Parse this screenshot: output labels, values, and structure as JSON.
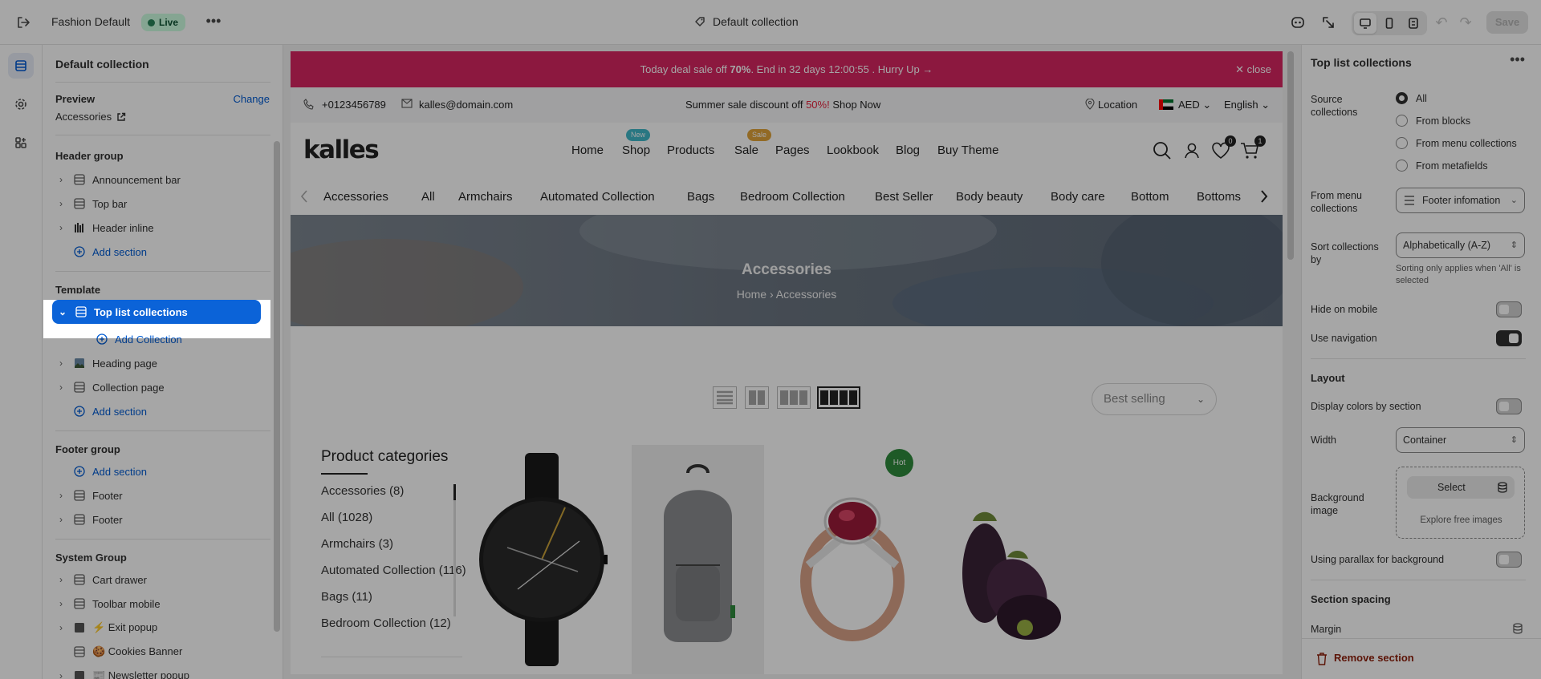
{
  "topbar": {
    "theme_name": "Fashion Default",
    "status_badge": "Live",
    "page_selector": "Default collection",
    "save_label": "Save"
  },
  "sidebar": {
    "title": "Default collection",
    "preview_label": "Preview",
    "preview_change": "Change",
    "preview_value": "Accessories",
    "header_group": {
      "label": "Header group",
      "items": [
        "Announcement bar",
        "Top bar",
        "Header inline"
      ],
      "add_section": "Add section"
    },
    "template": {
      "label": "Template",
      "selected": "Top list collections",
      "add_collection": "Add Collection",
      "items": [
        "Heading page",
        "Collection page"
      ],
      "add_section": "Add section"
    },
    "footer_group": {
      "label": "Footer group",
      "add_section": "Add section",
      "items": [
        "Footer",
        "Footer"
      ]
    },
    "system_group": {
      "label": "System Group",
      "items": [
        "Cart drawer",
        "Toolbar mobile",
        "⚡ Exit popup",
        "🍪 Cookies Banner",
        "📰 Newsletter popup"
      ]
    }
  },
  "preview": {
    "announcement": {
      "pre": "Today deal sale off ",
      "bold": "70%",
      "post": ". End in 32 days 12:00:55 .  Hurry Up →",
      "close": "close"
    },
    "topbar": {
      "phone": "+0123456789",
      "email": "kalles@domain.com",
      "promo_pre": "Summer sale discount off ",
      "promo_red": "50%!",
      "promo_link": " Shop Now",
      "location": "Location",
      "currency": "AED",
      "language": "English"
    },
    "header": {
      "logo": "kalles",
      "nav": [
        "Home",
        "Shop",
        "Products",
        "Sale",
        "Pages",
        "Lookbook",
        "Blog",
        "Buy Theme"
      ],
      "badge_new": "New",
      "badge_sale": "Sale",
      "wishlist_count": "0",
      "cart_count": "1"
    },
    "collections_nav": [
      "Accessories",
      "All",
      "Armchairs",
      "Automated Collection",
      "Bags",
      "Bedroom Collection",
      "Best Seller",
      "Body beauty",
      "Body care",
      "Bottom",
      "Bottoms"
    ],
    "hero": {
      "title": "Accessories",
      "crumb_home": "Home",
      "crumb_sep": "›",
      "crumb_current": "Accessories"
    },
    "sort": "Best selling",
    "categories": {
      "title": "Product categories",
      "items": [
        "Accessories  (8)",
        "All  (1028)",
        "Armchairs  (3)",
        "Automated Collection  (116)",
        "Bags  (11)",
        "Bedroom Collection  (12)"
      ]
    },
    "hot_badge": "Hot"
  },
  "settings": {
    "title": "Top list collections",
    "source_label": "Source collections",
    "source_options": [
      "All",
      "From blocks",
      "From menu collections",
      "From metafields"
    ],
    "source_selected": "All",
    "menu_label": "From menu collections",
    "menu_value": "Footer infomation",
    "sort_label": "Sort collections by",
    "sort_value": "Alphabetically (A-Z)",
    "sort_help": "Sorting only applies when 'All' is selected",
    "hide_mobile": "Hide on mobile",
    "hide_mobile_on": false,
    "use_nav": "Use navigation",
    "use_nav_on": true,
    "layout_title": "Layout",
    "display_colors": "Display colors by section",
    "display_colors_on": false,
    "width_label": "Width",
    "width_value": "Container",
    "bg_label": "Background image",
    "bg_select": "Select",
    "bg_explore": "Explore free images",
    "parallax": "Using parallax for background",
    "parallax_on": false,
    "spacing_title": "Section spacing",
    "margin_label": "Margin",
    "remove": "Remove section"
  },
  "colors": {
    "accent": "#005bd3",
    "selected": "#0b63d8",
    "announcement": "#d72662",
    "live_badge": "#cdfee1"
  }
}
